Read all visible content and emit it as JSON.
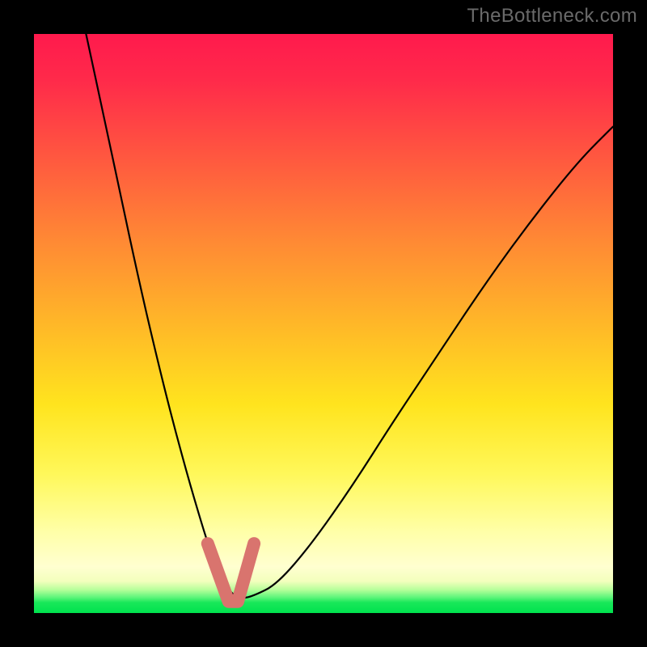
{
  "watermark": "TheBottleneck.com",
  "chart_data": {
    "type": "line",
    "title": "",
    "xlabel": "",
    "ylabel": "",
    "xlim": [
      0,
      100
    ],
    "ylim": [
      0,
      100
    ],
    "grid": false,
    "legend": false,
    "series": [
      {
        "name": "bottleneck-curve",
        "x": [
          9,
          12,
          15,
          18,
          21,
          24,
          27,
          30,
          31.5,
          33,
          34.5,
          36,
          38,
          42,
          48,
          55,
          62,
          70,
          78,
          86,
          94,
          100
        ],
        "y": [
          100,
          86,
          72,
          58,
          45,
          33,
          22,
          12,
          8,
          5,
          3,
          2.5,
          3,
          5,
          12,
          22,
          33,
          45,
          57,
          68,
          78,
          84
        ]
      }
    ],
    "annotations": [
      {
        "name": "valley-marker",
        "shape": "v-band",
        "color": "#d9746e",
        "x_range": [
          30,
          38
        ],
        "y_range": [
          2,
          12
        ]
      }
    ]
  }
}
